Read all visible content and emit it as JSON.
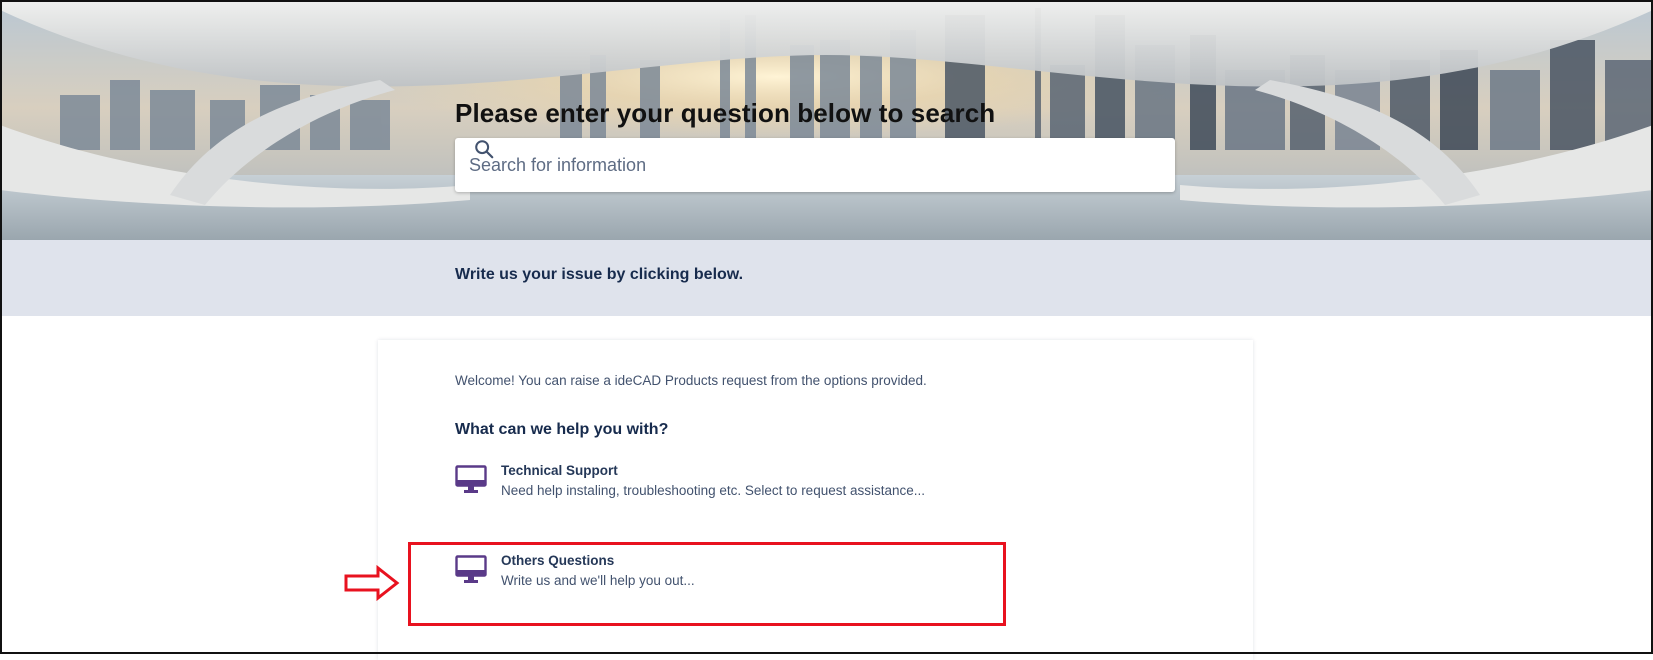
{
  "hero": {
    "title": "Please enter your question below to search"
  },
  "search": {
    "placeholder": "Search for information",
    "icon": "search-icon"
  },
  "band": {
    "text": "Write us your issue by clicking below."
  },
  "portal": {
    "welcome": "Welcome! You can raise a ideCAD Products request from the options provided.",
    "help_heading": "What can we help you with?",
    "request_types": [
      {
        "name": "Technical Support",
        "description": "Need help instaling, troubleshooting etc. Select to request assistance...",
        "icon": "monitor-icon"
      },
      {
        "name": "Others Questions",
        "description": "Write us and we'll help you out...",
        "icon": "monitor-icon"
      }
    ]
  },
  "annotation": {
    "highlight_color": "#e8121f",
    "arrow_icon": "right-arrow-icon"
  },
  "colors": {
    "band_bg": "#dfe3ec",
    "heading_text": "#172b4d",
    "body_text": "#42526e",
    "icon_purple": "#5a3a88"
  }
}
